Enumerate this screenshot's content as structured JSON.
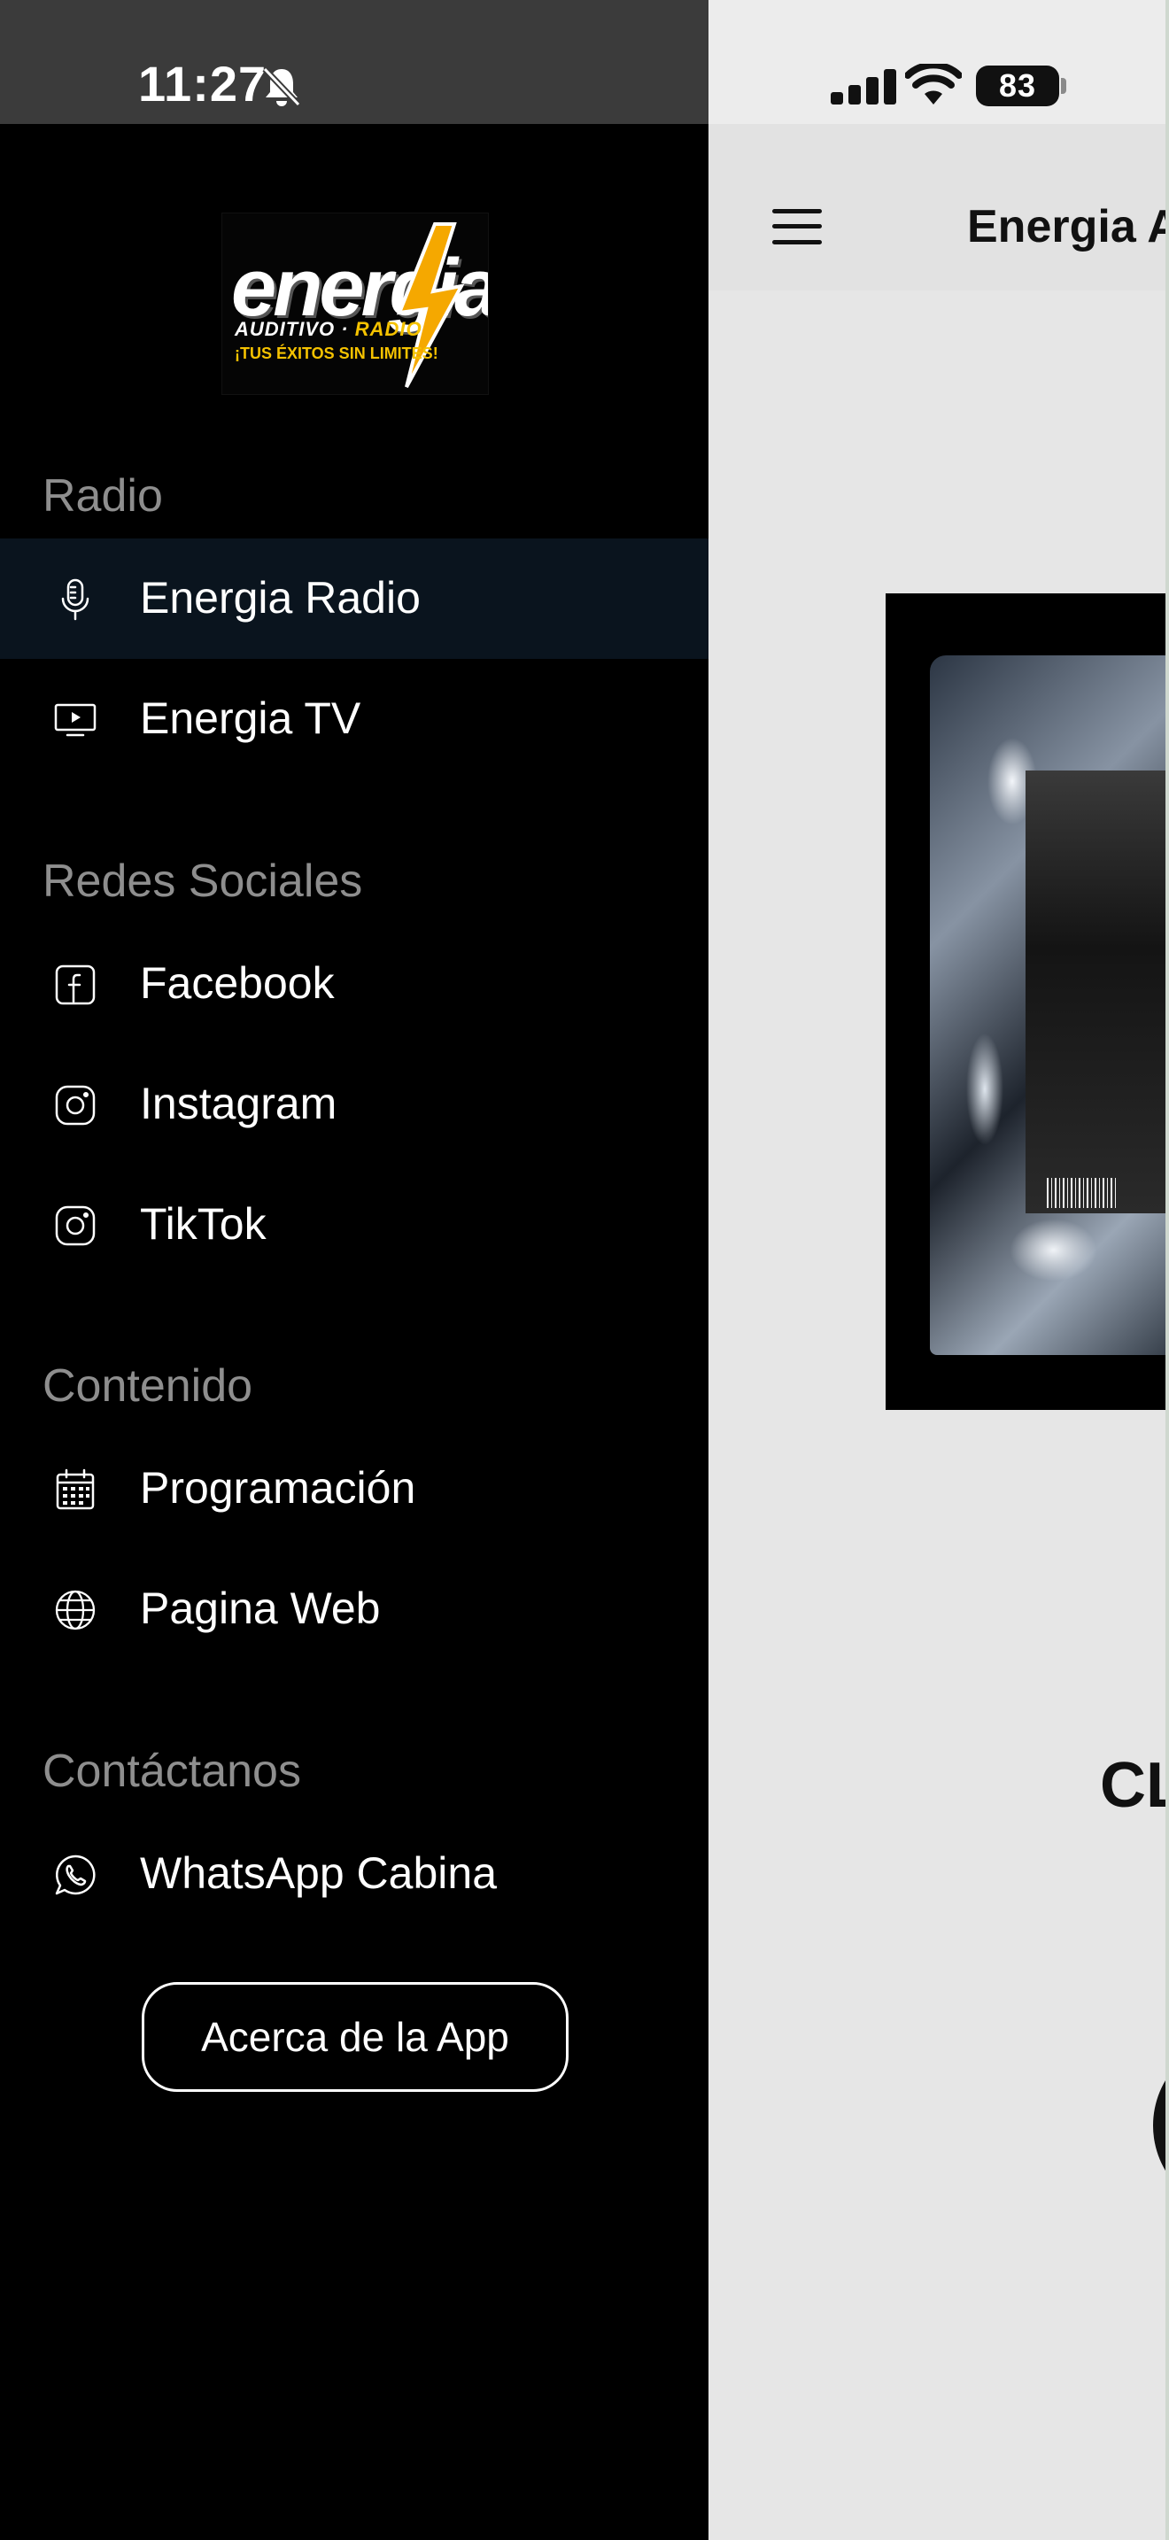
{
  "status_bar": {
    "time": "11:27",
    "battery": "83"
  },
  "header": {
    "title": "Energia A"
  },
  "now_playing": {
    "song_title": "CL"
  },
  "logo": {
    "word": "energia",
    "sub_left": "AUDITIVO",
    "sub_right": "RADIO",
    "tagline": "¡TUS ÉXITOS SIN LIMITES!"
  },
  "drawer": {
    "sections": [
      {
        "title": "Radio",
        "items": [
          {
            "label": "Energia Radio",
            "icon": "microphone-icon",
            "active": true
          },
          {
            "label": "Energia TV",
            "icon": "tv-icon",
            "active": false
          }
        ]
      },
      {
        "title": "Redes Sociales",
        "items": [
          {
            "label": "Facebook",
            "icon": "facebook-icon"
          },
          {
            "label": "Instagram",
            "icon": "instagram-icon"
          },
          {
            "label": "TikTok",
            "icon": "tiktok-icon"
          }
        ]
      },
      {
        "title": "Contenido",
        "items": [
          {
            "label": "Programación",
            "icon": "calendar-icon"
          },
          {
            "label": "Pagina Web",
            "icon": "globe-icon"
          }
        ]
      },
      {
        "title": "Contáctanos",
        "items": [
          {
            "label": "WhatsApp Cabina",
            "icon": "whatsapp-icon"
          }
        ]
      }
    ],
    "about_button": "Acerca de la App"
  },
  "colors": {
    "drawer_bg": "#000000",
    "active_item_bg": "#0a141e",
    "section_title": "#8e8e8e",
    "logo_accent": "#f5c200"
  }
}
